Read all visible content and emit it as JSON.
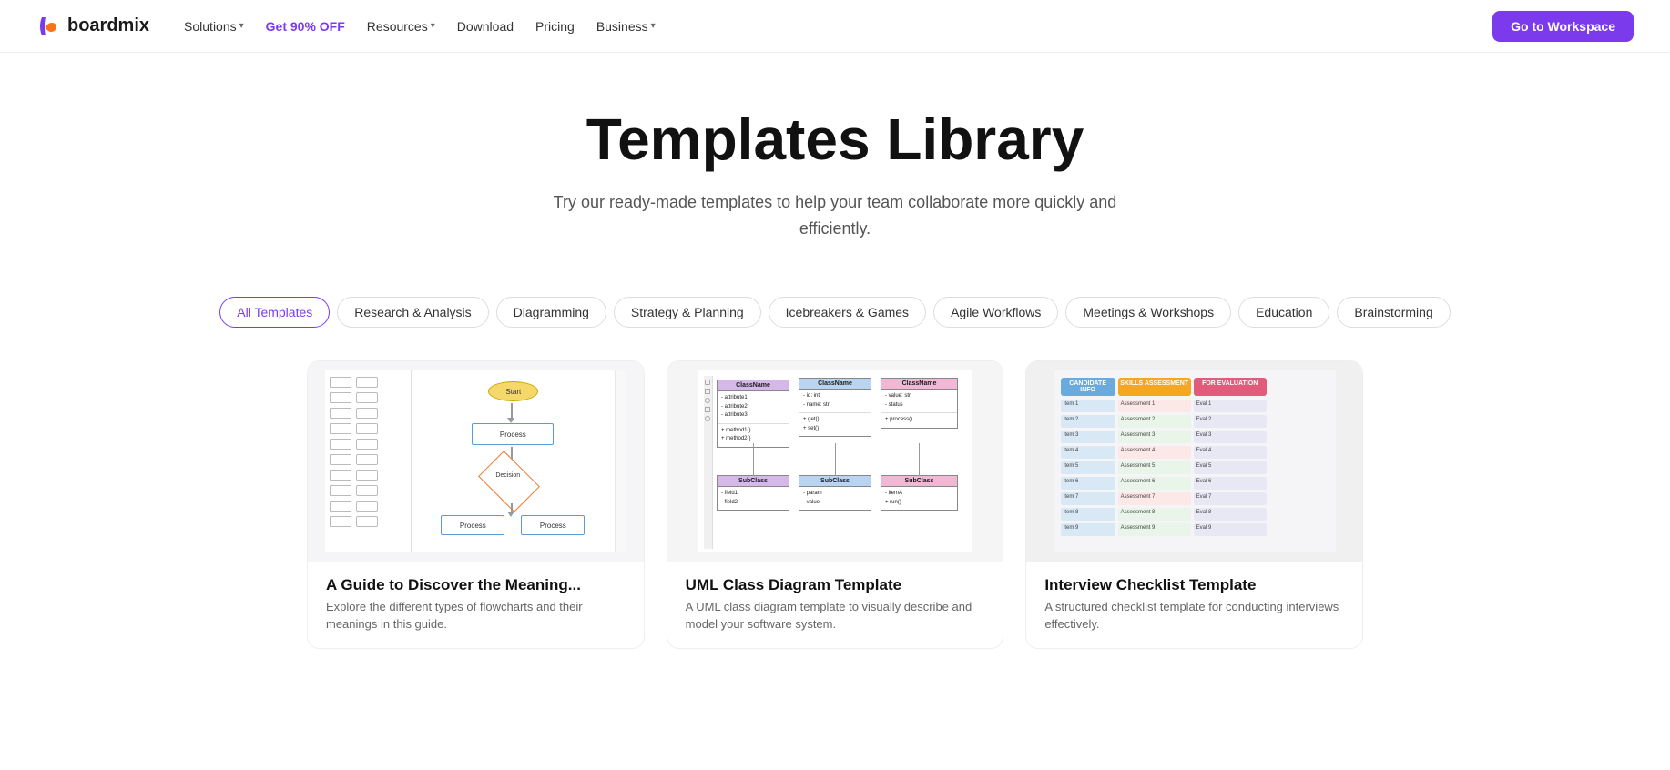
{
  "brand": {
    "name": "boardmix",
    "logo_letter": "b"
  },
  "nav": {
    "links": [
      {
        "id": "solutions",
        "label": "Solutions",
        "has_chevron": true,
        "highlight": false
      },
      {
        "id": "discount",
        "label": "Get 90% OFF",
        "has_chevron": false,
        "highlight": true
      },
      {
        "id": "resources",
        "label": "Resources",
        "has_chevron": true,
        "highlight": false
      },
      {
        "id": "download",
        "label": "Download",
        "has_chevron": false,
        "highlight": false
      },
      {
        "id": "pricing",
        "label": "Pricing",
        "has_chevron": false,
        "highlight": false
      },
      {
        "id": "business",
        "label": "Business",
        "has_chevron": true,
        "highlight": false
      }
    ],
    "cta_label": "Go to Workspace"
  },
  "hero": {
    "title": "Templates Library",
    "subtitle": "Try our ready-made templates to help your team collaborate more quickly and efficiently."
  },
  "filters": [
    {
      "id": "all",
      "label": "All Templates",
      "active": true
    },
    {
      "id": "research",
      "label": "Research & Analysis",
      "active": false
    },
    {
      "id": "diagramming",
      "label": "Diagramming",
      "active": false
    },
    {
      "id": "strategy",
      "label": "Strategy & Planning",
      "active": false
    },
    {
      "id": "icebreakers",
      "label": "Icebreakers & Games",
      "active": false
    },
    {
      "id": "agile",
      "label": "Agile Workflows",
      "active": false
    },
    {
      "id": "meetings",
      "label": "Meetings & Workshops",
      "active": false
    },
    {
      "id": "education",
      "label": "Education",
      "active": false
    },
    {
      "id": "brainstorming",
      "label": "Brainstorming",
      "active": false
    }
  ],
  "templates": [
    {
      "id": "flowchart",
      "title": "A Guide to Discover the Meaning...",
      "description": "Explore the different types of flowcharts and their meanings in this guide.",
      "type": "flowchart"
    },
    {
      "id": "uml",
      "title": "UML Class Diagram Template",
      "description": "A UML class diagram template to visually describe and model your software system.",
      "type": "uml"
    },
    {
      "id": "checklist",
      "title": "Interview Checklist Template",
      "description": "A structured checklist template for conducting interviews effectively.",
      "type": "checklist"
    }
  ]
}
